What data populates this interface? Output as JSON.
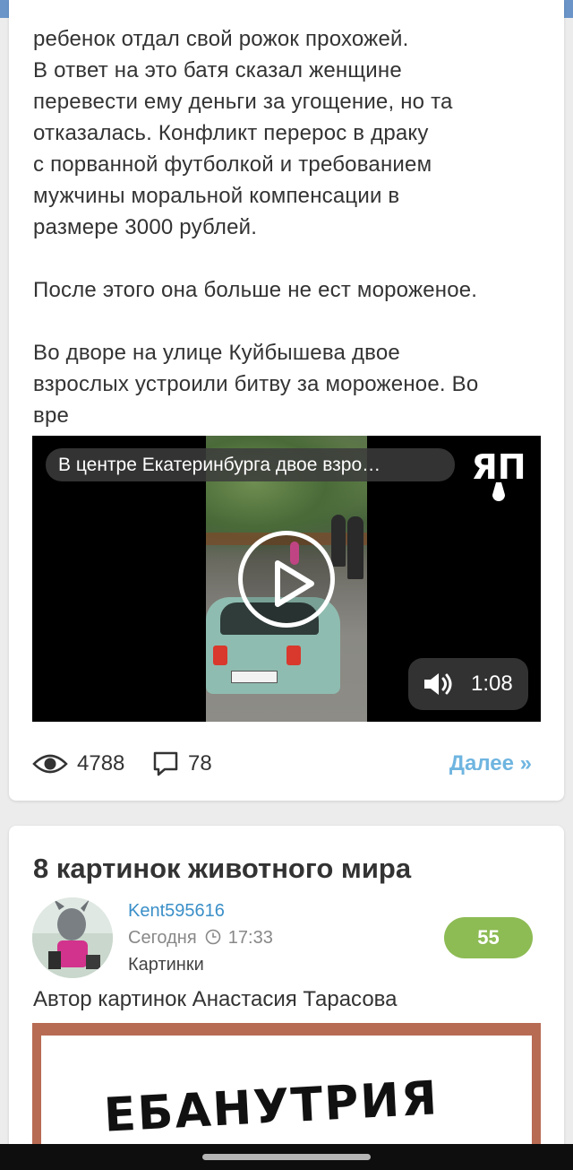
{
  "post1": {
    "text_lines": [
      "ребенок отдал свой рожок прохожей.",
      "В ответ на это батя сказал женщине",
      "перевести ему деньги за угощение, но та",
      "отказалась. Конфликт перерос в драку",
      "с порванной футболкой и требованием",
      "мужчины моральной компенсации в",
      "размере 3000 рублей."
    ],
    "text_paragraph2": "После этого она больше не ест мороженое.",
    "text_lines3": [
      "Во дворе на улице Куйбышева двое",
      "взрослых устроили битву за мороженое. Во",
      "вре"
    ],
    "video": {
      "title": "В центре Екатеринбурга двое взро…",
      "channel_logo": "ЯП",
      "duration": "1:08",
      "play_icon": "play-icon",
      "volume_icon": "volume-icon"
    },
    "stats": {
      "views": "4788",
      "comments": "78",
      "next_label": "Далее »"
    }
  },
  "post2": {
    "title": "8 картинок животного мира",
    "author": "Kent595616",
    "date_label": "Сегодня",
    "time": "17:33",
    "category": "Картинки",
    "rating": "55",
    "caption": "Автор картинок Анастасия Тарасова",
    "image_word": "ЕБАНУТРИЯ"
  },
  "colors": {
    "accent_blue": "#6b95c9",
    "link_blue": "#3a8fc8",
    "next_link": "#6fb5e0",
    "rating_green": "#8dbb54"
  }
}
